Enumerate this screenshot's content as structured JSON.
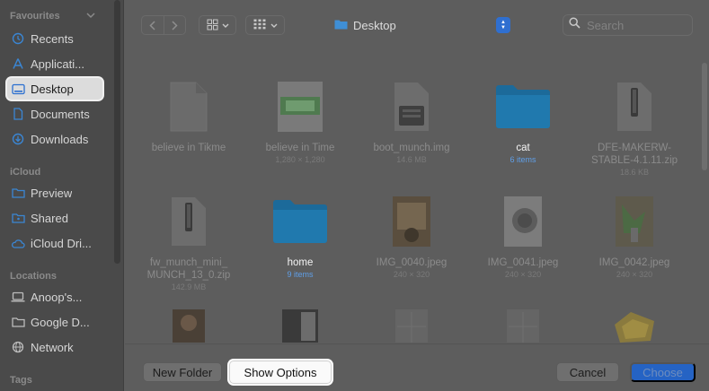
{
  "sidebar": {
    "favourites": {
      "header": "Favourites",
      "items": [
        {
          "label": "Recents",
          "icon": "clock-icon"
        },
        {
          "label": "Applicati...",
          "icon": "applications-icon"
        },
        {
          "label": "Desktop",
          "icon": "desktop-icon",
          "selected": true
        },
        {
          "label": "Documents",
          "icon": "document-icon"
        },
        {
          "label": "Downloads",
          "icon": "download-icon"
        }
      ]
    },
    "icloud": {
      "header": "iCloud",
      "items": [
        {
          "label": "Preview",
          "icon": "folder-icon"
        },
        {
          "label": "Shared",
          "icon": "shared-folder-icon"
        },
        {
          "label": "iCloud Dri...",
          "icon": "cloud-icon"
        }
      ]
    },
    "locations": {
      "header": "Locations",
      "items": [
        {
          "label": "Anoop's...",
          "icon": "laptop-icon"
        },
        {
          "label": "Google D...",
          "icon": "drive-icon"
        },
        {
          "label": "Network",
          "icon": "globe-icon"
        }
      ]
    },
    "tags": {
      "header": "Tags"
    }
  },
  "toolbar": {
    "location": "Desktop",
    "search_placeholder": "Search"
  },
  "files": [
    {
      "name": "believe in Tikme",
      "meta": "",
      "kind": "doc"
    },
    {
      "name": "believe in Time",
      "meta": "1,280 × 1,280",
      "kind": "time"
    },
    {
      "name": "boot_munch.img",
      "meta": "14.6 MB",
      "kind": "disk"
    },
    {
      "name": "cat",
      "meta": "6 items",
      "kind": "folder"
    },
    {
      "name": "DFE-MAKERW-\nSTABLE-4.1.11.zip",
      "meta": "18.6 KB",
      "kind": "zip"
    },
    {
      "name": "fw_munch_mini_\nMUNCH_13_0.zip",
      "meta": "142.9 MB",
      "kind": "zip"
    },
    {
      "name": "home",
      "meta": "9 items",
      "kind": "folder"
    },
    {
      "name": "IMG_0040.jpeg",
      "meta": "240 × 320",
      "kind": "photo1"
    },
    {
      "name": "IMG_0041.jpeg",
      "meta": "240 × 320",
      "kind": "photo2"
    },
    {
      "name": "IMG_0042.jpeg",
      "meta": "240 × 320",
      "kind": "photo3"
    },
    {
      "name": "",
      "meta": "",
      "kind": "face"
    },
    {
      "name": "",
      "meta": "",
      "kind": "dark"
    },
    {
      "name": "",
      "meta": "",
      "kind": "blank"
    },
    {
      "name": "",
      "meta": "",
      "kind": "blank"
    },
    {
      "name": "",
      "meta": "",
      "kind": "yellow"
    }
  ],
  "buttons": {
    "new_folder": "New Folder",
    "show_options": "Show Options",
    "cancel": "Cancel",
    "choose": "Choose"
  },
  "colors": {
    "accent": "#2f6fd0",
    "folder": "#1f6b9c",
    "highlight": "#fafafa"
  }
}
